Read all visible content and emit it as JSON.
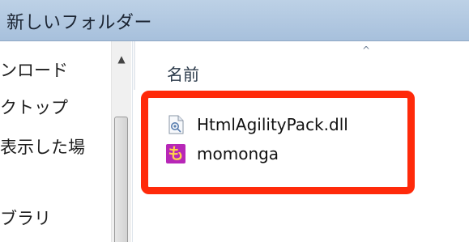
{
  "window": {
    "folder_title": "新しいフォルダー"
  },
  "sidebar": {
    "items": [
      {
        "label": "ンロード"
      },
      {
        "label": "クトップ"
      },
      {
        "label": "表示した場"
      },
      {
        "label": "ブラリ"
      }
    ],
    "scroll_up_glyph": "▲"
  },
  "file_list": {
    "column_header": "名前",
    "sort_glyph": "^",
    "files": [
      {
        "name": "HtmlAgilityPack.dll",
        "icon": "dll-file-icon"
      },
      {
        "name": "momonga",
        "icon": "momonga-app-icon",
        "icon_glyph": "も"
      }
    ]
  },
  "colors": {
    "highlight_border": "#ff2a0a",
    "titlebar": "#b3c9e2",
    "momonga_icon_bg": "#b727b7"
  }
}
